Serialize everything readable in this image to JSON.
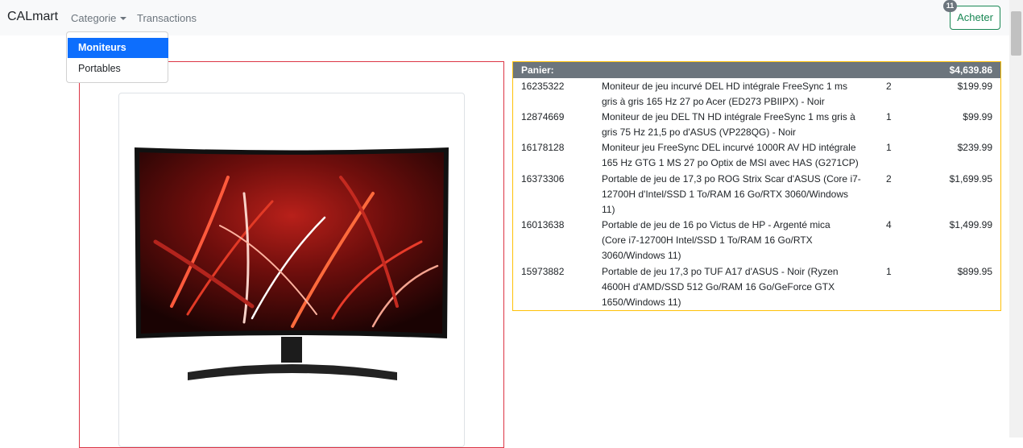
{
  "navbar": {
    "brand": "CALmart",
    "categorie_label": "Categorie",
    "transactions_label": "Transactions",
    "buy_label": "Acheter",
    "cart_count": "11"
  },
  "dropdown": {
    "items": [
      {
        "label": "Moniteurs",
        "active": true
      },
      {
        "label": "Portables",
        "active": false
      }
    ]
  },
  "product": {
    "image": "curved-monitor-image"
  },
  "cart": {
    "label": "Panier:",
    "total": "$4,639.86",
    "rows": [
      {
        "id": "16235322",
        "desc_lines": [
          "Moniteur de jeu incurvé DEL HD intégrale FreeSync 1 ms",
          "gris à gris 165 Hz 27 po Acer (ED273 PBIIPX) - Noir"
        ],
        "qty": "2",
        "price": "$199.99"
      },
      {
        "id": "12874669",
        "desc_lines": [
          "Moniteur de jeu DEL TN HD intégrale FreeSync 1 ms gris à",
          "gris 75 Hz 21,5 po d'ASUS (VP228QG) - Noir"
        ],
        "qty": "1",
        "price": "$99.99"
      },
      {
        "id": "16178128",
        "desc_lines": [
          "Moniteur jeu FreeSync DEL incurvé 1000R AV HD intégrale",
          "165 Hz GTG 1 MS 27 po Optix de MSI avec HAS (G271CP)"
        ],
        "qty": "1",
        "price": "$239.99"
      },
      {
        "id": "16373306",
        "desc_lines": [
          "Portable de jeu de 17,3 po ROG Strix Scar d'ASUS (Core i7-",
          "12700H d'Intel/SSD 1 To/RAM 16 Go/RTX 3060/Windows",
          "11)"
        ],
        "qty": "2",
        "price": "$1,699.95"
      },
      {
        "id": "16013638",
        "desc_lines": [
          "Portable de jeu de 16 po Victus de HP - Argenté mica",
          "(Core i7-12700H Intel/SSD 1 To/RAM 16 Go/RTX",
          "3060/Windows 11)"
        ],
        "qty": "4",
        "price": "$1,499.99"
      },
      {
        "id": "15973882",
        "desc_lines": [
          "Portable de jeu 17,3 po TUF A17 d'ASUS - Noir (Ryzen",
          "4600H d'AMD/SSD 512 Go/RAM 16 Go/GeForce GTX",
          "1650/Windows 11)"
        ],
        "qty": "1",
        "price": "$899.95"
      }
    ]
  },
  "colors": {
    "primary": "#0d6efd",
    "success": "#198754",
    "danger": "#dc3545",
    "warning": "#ffc107",
    "secondary": "#6c757d"
  }
}
